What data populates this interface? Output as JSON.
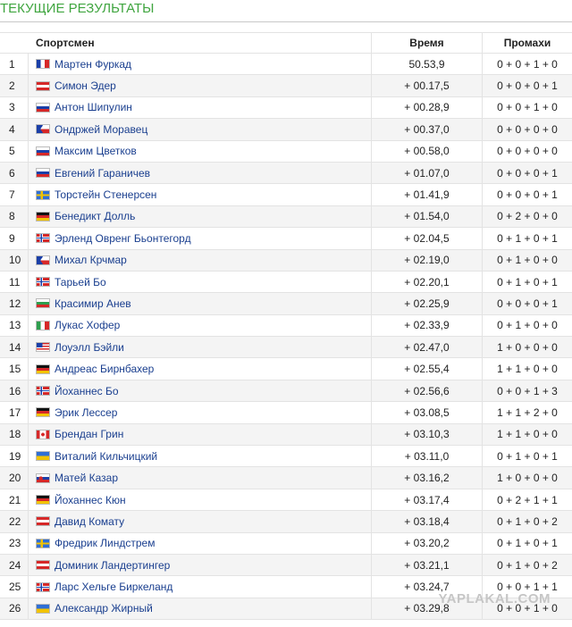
{
  "section": {
    "title": "ТЕКУЩИЕ РЕЗУЛЬТАТЫ"
  },
  "table": {
    "headers": {
      "rank": "",
      "athlete": "Спортсмен",
      "time": "Время",
      "misses": "Промахи"
    },
    "rows": [
      {
        "rank": "1",
        "country": "france",
        "athlete": "Мартен Фуркад",
        "time": "50.53,9",
        "misses": "0 + 0 + 1 + 0"
      },
      {
        "rank": "2",
        "country": "austria",
        "athlete": "Симон Эдер",
        "time": "+ 00.17,5",
        "misses": "0 + 0 + 0 + 1"
      },
      {
        "rank": "3",
        "country": "russia",
        "athlete": "Антон Шипулин",
        "time": "+ 00.28,9",
        "misses": "0 + 0 + 1 + 0"
      },
      {
        "rank": "4",
        "country": "czech",
        "athlete": "Ондржей Моравец",
        "time": "+ 00.37,0",
        "misses": "0 + 0 + 0 + 0"
      },
      {
        "rank": "5",
        "country": "russia",
        "athlete": "Максим Цветков",
        "time": "+ 00.58,0",
        "misses": "0 + 0 + 0 + 0"
      },
      {
        "rank": "6",
        "country": "russia",
        "athlete": "Евгений Гараничев",
        "time": "+ 01.07,0",
        "misses": "0 + 0 + 0 + 1"
      },
      {
        "rank": "7",
        "country": "sweden",
        "athlete": "Торстейн Стенерсен",
        "time": "+ 01.41,9",
        "misses": "0 + 0 + 0 + 1"
      },
      {
        "rank": "8",
        "country": "germany",
        "athlete": "Бенедикт Долль",
        "time": "+ 01.54,0",
        "misses": "0 + 2 + 0 + 0"
      },
      {
        "rank": "9",
        "country": "norway",
        "athlete": "Эрленд Овренг Бьонтегорд",
        "time": "+ 02.04,5",
        "misses": "0 + 1 + 0 + 1"
      },
      {
        "rank": "10",
        "country": "czech",
        "athlete": "Михал Крчмар",
        "time": "+ 02.19,0",
        "misses": "0 + 1 + 0 + 0"
      },
      {
        "rank": "11",
        "country": "norway",
        "athlete": "Тарьей Бо",
        "time": "+ 02.20,1",
        "misses": "0 + 1 + 0 + 1"
      },
      {
        "rank": "12",
        "country": "bulgaria",
        "athlete": "Красимир Анев",
        "time": "+ 02.25,9",
        "misses": "0 + 0 + 0 + 1"
      },
      {
        "rank": "13",
        "country": "italy",
        "athlete": "Лукас Хофер",
        "time": "+ 02.33,9",
        "misses": "0 + 1 + 0 + 0"
      },
      {
        "rank": "14",
        "country": "usa",
        "athlete": "Лоуэлл Бэйли",
        "time": "+ 02.47,0",
        "misses": "1 + 0 + 0 + 0"
      },
      {
        "rank": "15",
        "country": "germany",
        "athlete": "Андреас Бирнбахер",
        "time": "+ 02.55,4",
        "misses": "1 + 1 + 0 + 0"
      },
      {
        "rank": "16",
        "country": "norway",
        "athlete": "Йоханнес Бо",
        "time": "+ 02.56,6",
        "misses": "0 + 0 + 1 + 3"
      },
      {
        "rank": "17",
        "country": "germany",
        "athlete": "Эрик Лессер",
        "time": "+ 03.08,5",
        "misses": "1 + 1 + 2 + 0"
      },
      {
        "rank": "18",
        "country": "canada",
        "athlete": "Брендан Грин",
        "time": "+ 03.10,3",
        "misses": "1 + 1 + 0 + 0"
      },
      {
        "rank": "19",
        "country": "ukraine",
        "athlete": "Виталий Кильчицкий",
        "time": "+ 03.11,0",
        "misses": "0 + 1 + 0 + 1"
      },
      {
        "rank": "20",
        "country": "slovakia",
        "athlete": "Матей Казар",
        "time": "+ 03.16,2",
        "misses": "1 + 0 + 0 + 0"
      },
      {
        "rank": "21",
        "country": "germany",
        "athlete": "Йоханнес Кюн",
        "time": "+ 03.17,4",
        "misses": "0 + 2 + 1 + 1"
      },
      {
        "rank": "22",
        "country": "austria",
        "athlete": "Давид Комату",
        "time": "+ 03.18,4",
        "misses": "0 + 1 + 0 + 2"
      },
      {
        "rank": "23",
        "country": "sweden",
        "athlete": "Фредрик Линдстрем",
        "time": "+ 03.20,2",
        "misses": "0 + 1 + 0 + 1"
      },
      {
        "rank": "24",
        "country": "austria",
        "athlete": "Доминик Ландертингер",
        "time": "+ 03.21,1",
        "misses": "0 + 1 + 0 + 2"
      },
      {
        "rank": "25",
        "country": "norway",
        "athlete": "Ларс Хельге Биркеланд",
        "time": "+ 03.24,7",
        "misses": "0 + 0 + 1 + 1"
      },
      {
        "rank": "26",
        "country": "ukraine",
        "athlete": "Александр Жирный",
        "time": "+ 03.29,8",
        "misses": "0 + 0 + 1 + 0"
      }
    ]
  },
  "flags": {
    "france": [
      "#1a3fa8",
      "#ffffff",
      "#d62828"
    ],
    "austria": [
      "#d62828",
      "#ffffff",
      "#d62828"
    ],
    "russia": [
      "#ffffff",
      "#1a3fa8",
      "#d62828"
    ],
    "germany": [
      "#111111",
      "#d62828",
      "#f2c300"
    ],
    "bulgaria": [
      "#ffffff",
      "#2e9e4e",
      "#d62828"
    ],
    "italy": [
      "#2e9e4e",
      "#ffffff",
      "#d62828"
    ],
    "ukraine": [
      "#2f6fd6",
      "#f2c300"
    ],
    "sweden": [
      "#2f6fd6",
      "#f2c300"
    ],
    "norway": [
      "#d62828",
      "#ffffff",
      "#1a3fa8"
    ],
    "czech": [
      "#ffffff",
      "#d62828",
      "#1a3fa8"
    ],
    "canada": [
      "#d62828",
      "#ffffff"
    ],
    "usa": [
      "#d62828",
      "#ffffff",
      "#1a3fa8"
    ],
    "slovakia": [
      "#ffffff",
      "#1a3fa8",
      "#d62828"
    ]
  },
  "watermark": "YAPLAKAL.COM"
}
